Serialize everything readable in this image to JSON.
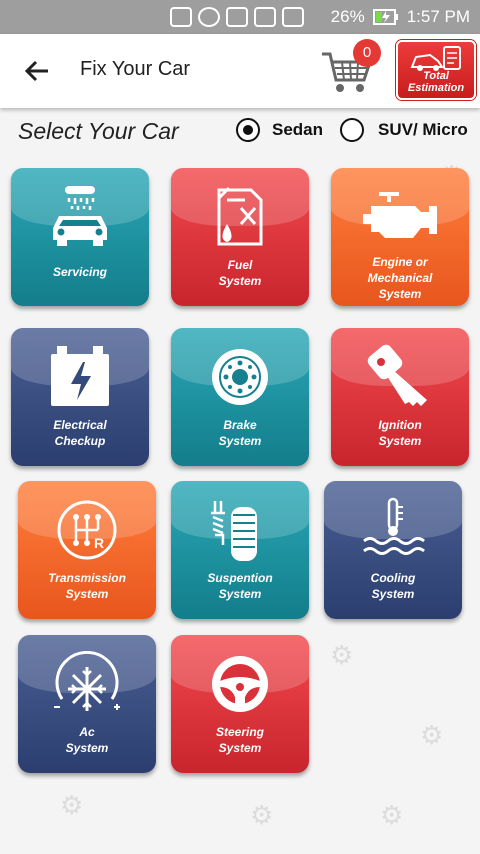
{
  "status_bar": {
    "battery": "26%",
    "time": "1:57 PM"
  },
  "app_bar": {
    "title": "Fix Your Car",
    "cart_count": "0",
    "estimate_label_1": "Total",
    "estimate_label_2": "Estimation"
  },
  "select": {
    "label": "Select Your Car",
    "options": [
      "Sedan",
      "SUV/ Micro"
    ],
    "selected": "Sedan"
  },
  "tiles": [
    {
      "line1": "Servicing",
      "line2": "",
      "line3": "",
      "color": "#1f97a6",
      "icon": "car-wash-icon"
    },
    {
      "line1": "Fuel",
      "line2": "System",
      "line3": "",
      "color": "#e0353a",
      "icon": "fuel-can-icon"
    },
    {
      "line1": "Engine or",
      "line2": "Mechanical",
      "line3": "System",
      "color": "#f26a2e",
      "icon": "engine-icon"
    },
    {
      "line1": "Electrical",
      "line2": "Checkup",
      "line3": "",
      "color": "#34497c",
      "icon": "battery-icon"
    },
    {
      "line1": "Brake",
      "line2": "System",
      "line3": "",
      "color": "#1f97a6",
      "icon": "brake-disc-icon"
    },
    {
      "line1": "Ignition",
      "line2": "System",
      "line3": "",
      "color": "#e0353a",
      "icon": "car-key-icon"
    },
    {
      "line1": "Transmission",
      "line2": "System",
      "line3": "",
      "color": "#f26a2e",
      "icon": "gear-shift-icon"
    },
    {
      "line1": "Suspention",
      "line2": "System",
      "line3": "",
      "color": "#1f97a6",
      "icon": "suspension-icon"
    },
    {
      "line1": "Cooling",
      "line2": "System",
      "line3": "",
      "color": "#34497c",
      "icon": "coolant-icon"
    },
    {
      "line1": "Ac",
      "line2": "System",
      "line3": "",
      "color": "#34497c",
      "icon": "snowflake-icon"
    },
    {
      "line1": "Steering",
      "line2": "System",
      "line3": "",
      "color": "#e0353a",
      "icon": "steering-wheel-icon"
    }
  ]
}
